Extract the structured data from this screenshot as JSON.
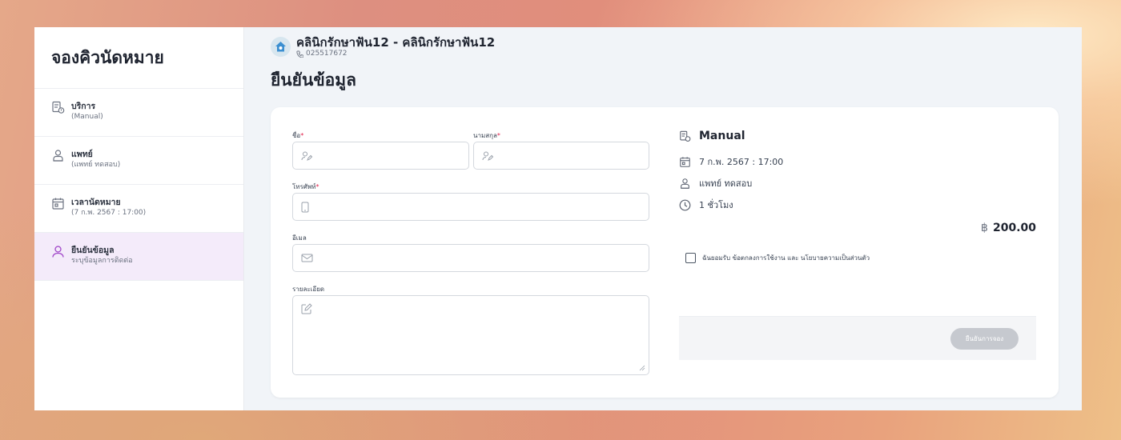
{
  "sidebar": {
    "title": "จองคิวนัดหมาย",
    "steps": [
      {
        "label": "บริการ",
        "sub": "(Manual)"
      },
      {
        "label": "แพทย์",
        "sub": "(แพทย์ ทดสอบ)"
      },
      {
        "label": "เวลานัดหมาย",
        "sub": "(7 ก.พ. 2567 : 17:00)"
      },
      {
        "label": "ยืนยันข้อมูล",
        "sub": "ระบุข้อมูลการติดต่อ"
      }
    ],
    "active_color": "#a045c8"
  },
  "clinic": {
    "name": "คลินิกรักษาฟัน12 - คลินิกรักษาฟัน12",
    "phone": "025517672"
  },
  "page_title": "ยืนยันข้อมูล",
  "form": {
    "first_name_label": "ชื่อ",
    "last_name_label": "นามสกุล",
    "phone_label": "โทรศัพท์",
    "email_label": "อีเมล",
    "detail_label": "รายละเอียด",
    "required_mark": "*"
  },
  "summary": {
    "service": "Manual",
    "datetime": "7 ก.พ. 2567 : 17:00",
    "doctor": "แพทย์ ทดสอบ",
    "duration": "1 ชั่วโมง",
    "currency_symbol": "฿",
    "price": "200.00",
    "agree_text": "ฉันยอมรับ ข้อตกลงการใช้งาน และ นโยบายความเป็นส่วนตัว",
    "confirm_button": "ยืนยันการจอง"
  }
}
